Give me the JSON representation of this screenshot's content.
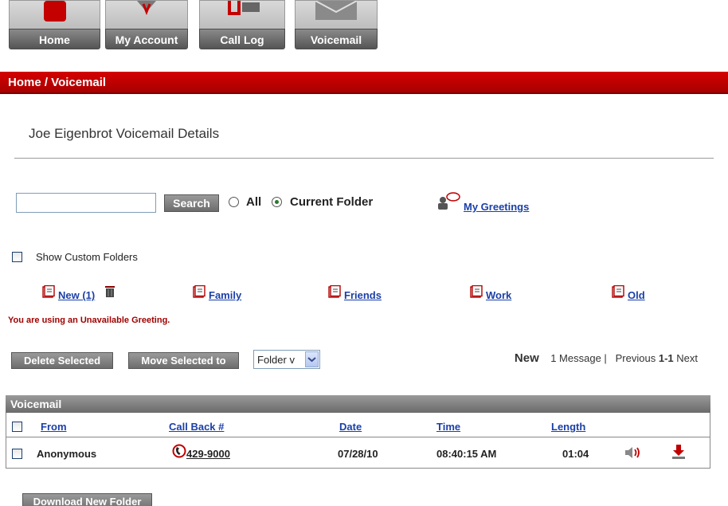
{
  "nav": {
    "tabs": [
      {
        "label": "Home"
      },
      {
        "label": "My Account"
      },
      {
        "label": "Call Log"
      },
      {
        "label": "Voicemail"
      }
    ]
  },
  "breadcrumb": "Home / Voicemail",
  "page_title": "Joe Eigenbrot Voicemail Details",
  "search": {
    "value": "",
    "button_label": "Search",
    "scope_all": "All",
    "scope_current": "Current Folder",
    "selected_scope": "Current Folder"
  },
  "greetings_link": "My Greetings",
  "custom_folders_label": "Show Custom Folders",
  "folders": [
    {
      "label": "New (1)"
    },
    {
      "label": "Family"
    },
    {
      "label": "Friends"
    },
    {
      "label": "Work"
    },
    {
      "label": "Old"
    }
  ],
  "warning": "You are using an Unavailable Greeting.",
  "actions": {
    "delete_selected": "Delete Selected",
    "move_selected": "Move Selected to",
    "folder_select_value": "Folder v"
  },
  "pager": {
    "folder": "New",
    "count": "1 Message",
    "previous": "Previous",
    "range": "1-1",
    "next": "Next"
  },
  "table": {
    "title": "Voicemail",
    "columns": [
      "From",
      "Call Back #",
      "Date",
      "Time",
      "Length"
    ],
    "rows": [
      {
        "from": "Anonymous",
        "callback": "429-9000",
        "date": "07/28/10",
        "time": "08:40:15 AM",
        "length": "01:04"
      }
    ]
  },
  "download_button": "Download New Folder",
  "colors": {
    "brand_red": "#c00000",
    "link_blue": "#1a3fa8",
    "warning_red": "#a00000"
  },
  "icons": {
    "play": "speaker-icon",
    "download": "download-icon",
    "phone": "phone-icon",
    "trash": "trash-icon",
    "folder": "document-icon",
    "greetings": "greetings-icon"
  }
}
